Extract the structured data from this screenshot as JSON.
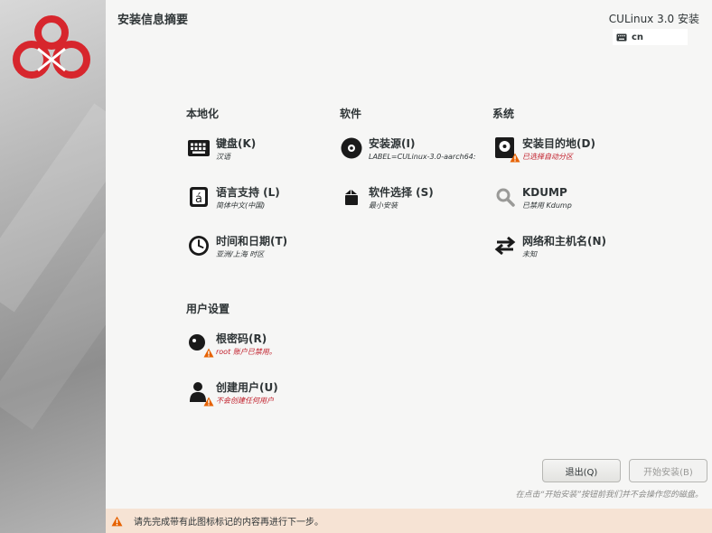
{
  "header": {
    "title": "安装信息摘要",
    "product": "CULinux 3.0 安装",
    "keyboard_indicator": "cn"
  },
  "columns": {
    "localization": "本地化",
    "software": "软件",
    "system": "系统",
    "user_settings": "用户设置"
  },
  "spokes": {
    "keyboard": {
      "name": "键盘(K)",
      "status": "汉语"
    },
    "language": {
      "name": "语言支持 (L)",
      "status": "简体中文(中国)"
    },
    "datetime": {
      "name": "时间和日期(T)",
      "status": "亚洲/上海 时区"
    },
    "source": {
      "name": "安装源(I)",
      "status": "LABEL=CULinux-3.0-aarch64:"
    },
    "software": {
      "name": "软件选择 (S)",
      "status": "最小安装"
    },
    "destination": {
      "name": "安装目的地(D)",
      "status": "已选择自动分区"
    },
    "kdump": {
      "name": "KDUMP",
      "status": "已禁用 Kdump"
    },
    "network": {
      "name": "网络和主机名(N)",
      "status": "未知"
    },
    "root": {
      "name": "根密码(R)",
      "status": "root 账户已禁用。"
    },
    "user": {
      "name": "创建用户(U)",
      "status": "不会创建任何用户"
    }
  },
  "buttons": {
    "quit": "退出(Q)",
    "begin": "开始安装(B)"
  },
  "hint": "在点击“开始安装”按钮前我们并不会操作您的磁盘。",
  "footer": "请先完成带有此图标标记的内容再进行下一步。",
  "colors": {
    "warning": "#e66100",
    "error_text": "#c01c28",
    "logo": "#d7262d",
    "footer_bg": "#f6e3d4"
  }
}
